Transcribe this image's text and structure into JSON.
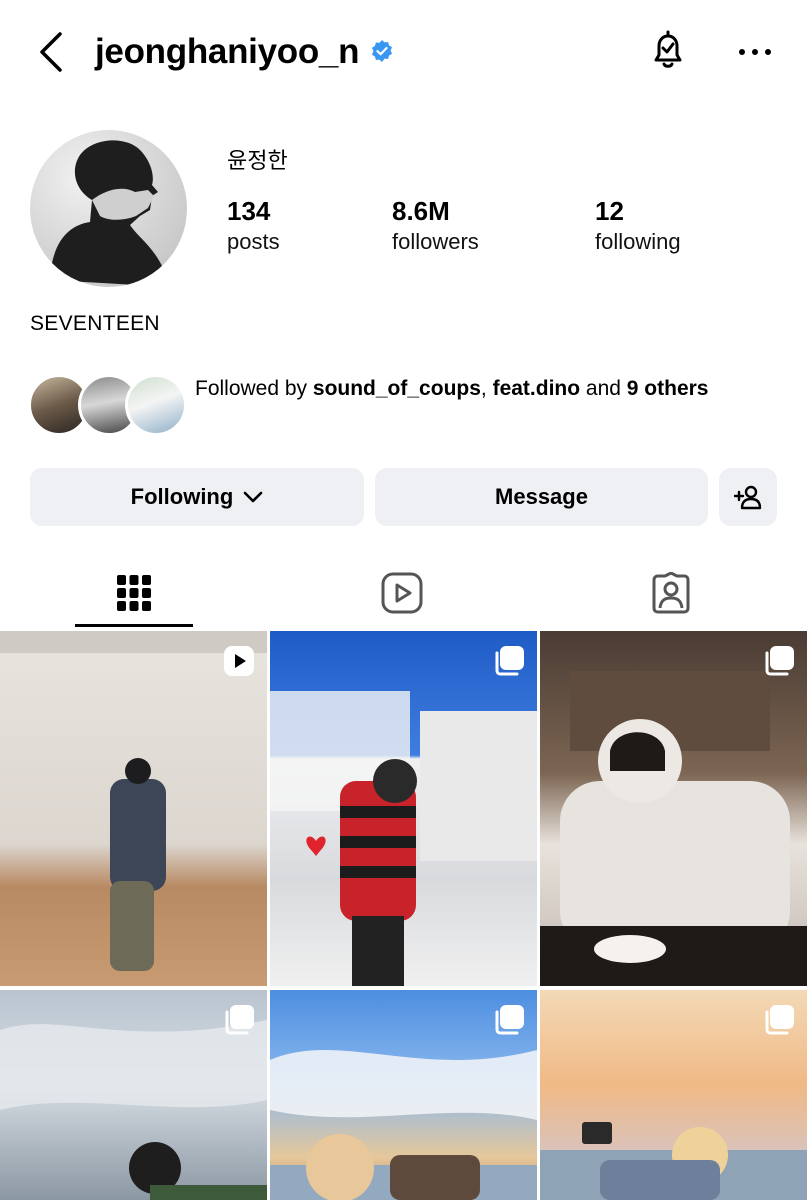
{
  "header": {
    "username": "jeonghaniyoo_n",
    "verified": true,
    "icons": [
      "back-chevron-icon",
      "verified-badge-icon",
      "notification-bell-icon",
      "more-dots-icon"
    ]
  },
  "profile": {
    "display_name": "윤정한",
    "stats": {
      "posts": {
        "value": "134",
        "label": "posts"
      },
      "followers": {
        "value": "8.6M",
        "label": "followers"
      },
      "following": {
        "value": "12",
        "label": "following"
      }
    },
    "bio": "SEVENTEEN"
  },
  "followed_by": {
    "prefix": "Followed by ",
    "user1": "sound_of_coups",
    "separator": ", ",
    "user2": "feat.dino",
    "and": " and ",
    "others": "9 others"
  },
  "actions": {
    "following_label": "Following",
    "message_label": "Message",
    "add_user_icon": "add-person-icon"
  },
  "tabs": [
    {
      "name": "posts-grid",
      "icon": "grid-icon",
      "active": true
    },
    {
      "name": "reels",
      "icon": "reels-icon",
      "active": false
    },
    {
      "name": "tagged",
      "icon": "tagged-person-icon",
      "active": false
    }
  ],
  "posts": [
    {
      "type": "reel",
      "badge": "reel-icon"
    },
    {
      "type": "carousel",
      "badge": "carousel-icon"
    },
    {
      "type": "carousel",
      "badge": "carousel-icon"
    },
    {
      "type": "carousel",
      "badge": "carousel-icon"
    },
    {
      "type": "carousel",
      "badge": "carousel-icon"
    },
    {
      "type": "carousel",
      "badge": "carousel-icon"
    }
  ],
  "colors": {
    "verified": "#3897f0",
    "button_bg": "#eef0f3",
    "text": "#000000"
  }
}
